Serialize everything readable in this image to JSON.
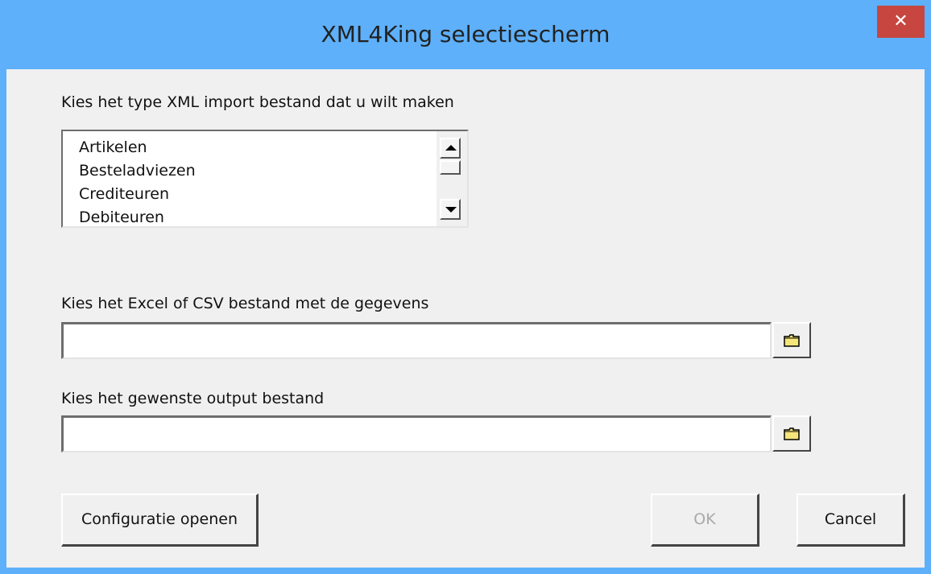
{
  "window": {
    "title": "XML4King selectiescherm",
    "close_label": "✕"
  },
  "type_section": {
    "label": "Kies het type XML import bestand dat u wilt maken",
    "items": [
      "Artikelen",
      "Besteladviezen",
      "Crediteuren",
      "Debiteuren"
    ]
  },
  "input_section": {
    "label": "Kies het Excel of CSV bestand met de gegevens",
    "value": ""
  },
  "output_section": {
    "label": "Kies het gewenste output bestand",
    "value": ""
  },
  "buttons": {
    "config_label": "Configuratie openen",
    "ok_label": "OK",
    "cancel_label": "Cancel"
  },
  "colors": {
    "titlebar": "#5eb0fa",
    "close": "#c7463f",
    "dialog_bg": "#f0f0f0",
    "folder": "#f5e67a"
  }
}
